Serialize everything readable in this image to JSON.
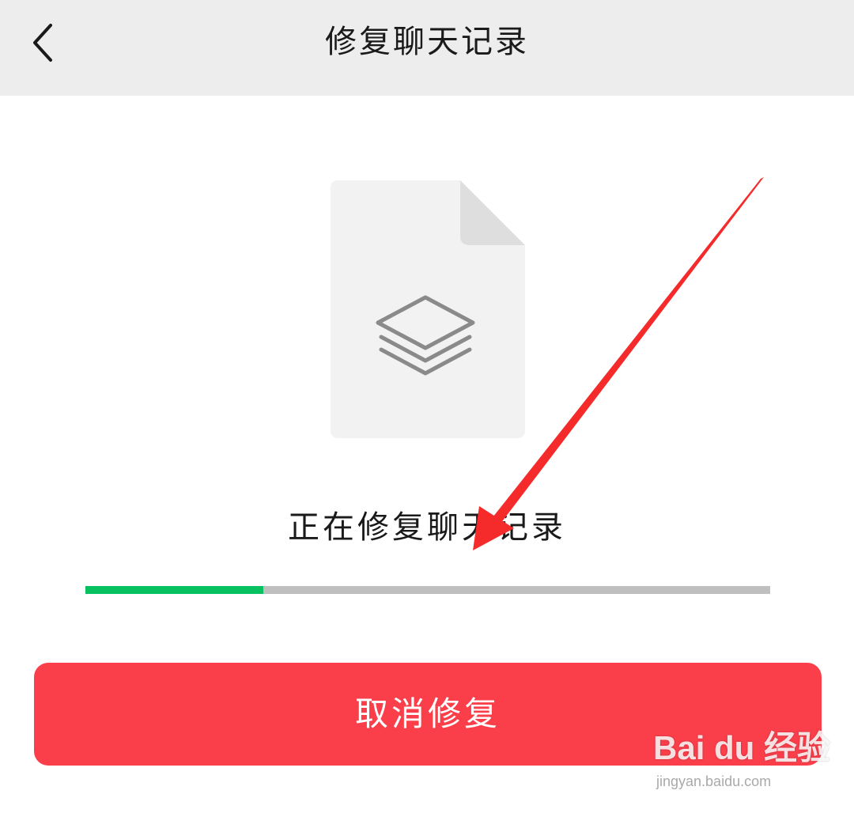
{
  "header": {
    "title": "修复聊天记录",
    "back_icon": "chevron-left-icon"
  },
  "file_icon": {
    "icon": "layers-icon"
  },
  "status": {
    "text": "正在修复聊天记录"
  },
  "progress": {
    "value": 0.26,
    "fill_color": "#07c160",
    "track_color": "#bfbfbf"
  },
  "cancel_button": {
    "label": "取消修复",
    "color": "#fa3e4a"
  },
  "watermark": {
    "logo": "Bai du 经验",
    "url": "jingyan.baidu.com"
  },
  "colors": {
    "header_bg": "#ededed",
    "annotation_arrow": "#f52a2a"
  }
}
